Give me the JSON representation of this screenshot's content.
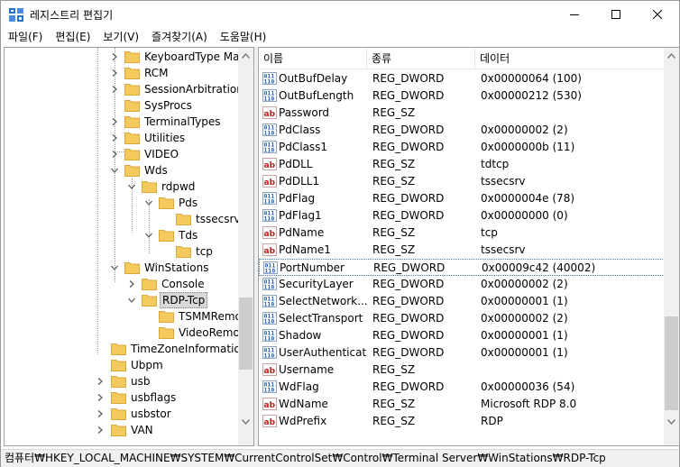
{
  "window": {
    "title": "레지스트리 편집기"
  },
  "menu": [
    "파일(F)",
    "편집(E)",
    "보기(V)",
    "즐겨찾기(A)",
    "도움말(H)"
  ],
  "tree": [
    {
      "label": "KeyboardType Map",
      "expander": "collapsed"
    },
    {
      "label": "RCM",
      "expander": "collapsed"
    },
    {
      "label": "SessionArbitrationHelper",
      "expander": "collapsed"
    },
    {
      "label": "SysProcs",
      "expander": "none"
    },
    {
      "label": "TerminalTypes",
      "expander": "collapsed"
    },
    {
      "label": "Utilities",
      "expander": "collapsed"
    },
    {
      "label": "VIDEO",
      "expander": "collapsed"
    },
    {
      "label": "Wds",
      "expander": "expanded"
    },
    {
      "label": "rdpwd",
      "expander": "expanded"
    },
    {
      "label": "Pds",
      "expander": "expanded"
    },
    {
      "label": "tssecsrv",
      "expander": "none"
    },
    {
      "label": "Tds",
      "expander": "expanded"
    },
    {
      "label": "tcp",
      "expander": "none"
    },
    {
      "label": "WinStations",
      "expander": "expanded"
    },
    {
      "label": "Console",
      "expander": "collapsed"
    },
    {
      "label": "RDP-Tcp",
      "expander": "expanded",
      "selected": true
    },
    {
      "label": "TSMMRemotingAllowedApps",
      "expander": "none"
    },
    {
      "label": "VideoRemotingWindowNames",
      "expander": "none"
    },
    {
      "label": "TimeZoneInformation",
      "expander": "none"
    },
    {
      "label": "Ubpm",
      "expander": "none"
    },
    {
      "label": "usb",
      "expander": "collapsed"
    },
    {
      "label": "usbflags",
      "expander": "collapsed"
    },
    {
      "label": "usbstor",
      "expander": "collapsed"
    },
    {
      "label": "VAN",
      "expander": "collapsed"
    }
  ],
  "list": {
    "columns": [
      "이름",
      "종류",
      "데이터"
    ],
    "rows": [
      {
        "icon": "binary",
        "name": "OutBufDelay",
        "type": "REG_DWORD",
        "data": "0x00000064 (100)"
      },
      {
        "icon": "binary",
        "name": "OutBufLength",
        "type": "REG_DWORD",
        "data": "0x00000212 (530)"
      },
      {
        "icon": "string",
        "name": "Password",
        "type": "REG_SZ",
        "data": ""
      },
      {
        "icon": "binary",
        "name": "PdClass",
        "type": "REG_DWORD",
        "data": "0x00000002 (2)"
      },
      {
        "icon": "binary",
        "name": "PdClass1",
        "type": "REG_DWORD",
        "data": "0x0000000b (11)"
      },
      {
        "icon": "string",
        "name": "PdDLL",
        "type": "REG_SZ",
        "data": "tdtcp"
      },
      {
        "icon": "string",
        "name": "PdDLL1",
        "type": "REG_SZ",
        "data": "tssecsrv"
      },
      {
        "icon": "binary",
        "name": "PdFlag",
        "type": "REG_DWORD",
        "data": "0x0000004e (78)"
      },
      {
        "icon": "binary",
        "name": "PdFlag1",
        "type": "REG_DWORD",
        "data": "0x00000000 (0)"
      },
      {
        "icon": "string",
        "name": "PdName",
        "type": "REG_SZ",
        "data": "tcp"
      },
      {
        "icon": "string",
        "name": "PdName1",
        "type": "REG_SZ",
        "data": "tssecsrv"
      },
      {
        "icon": "binary",
        "name": "PortNumber",
        "type": "REG_DWORD",
        "data": "0x00009c42 (40002)",
        "selected": true
      },
      {
        "icon": "binary",
        "name": "SecurityLayer",
        "type": "REG_DWORD",
        "data": "0x00000002 (2)"
      },
      {
        "icon": "binary",
        "name": "SelectNetwork...",
        "type": "REG_DWORD",
        "data": "0x00000001 (1)"
      },
      {
        "icon": "binary",
        "name": "SelectTransport",
        "type": "REG_DWORD",
        "data": "0x00000002 (2)"
      },
      {
        "icon": "binary",
        "name": "Shadow",
        "type": "REG_DWORD",
        "data": "0x00000001 (1)"
      },
      {
        "icon": "binary",
        "name": "UserAuthenticat...",
        "type": "REG_DWORD",
        "data": "0x00000001 (1)"
      },
      {
        "icon": "string",
        "name": "Username",
        "type": "REG_SZ",
        "data": ""
      },
      {
        "icon": "binary",
        "name": "WdFlag",
        "type": "REG_DWORD",
        "data": "0x00000036 (54)"
      },
      {
        "icon": "string",
        "name": "WdName",
        "type": "REG_SZ",
        "data": "Microsoft RDP 8.0"
      },
      {
        "icon": "string",
        "name": "WdPrefix",
        "type": "REG_SZ",
        "data": "RDP"
      }
    ]
  },
  "status": {
    "path": "컴퓨터₩HKEY_LOCAL_MACHINE₩SYSTEM₩CurrentControlSet₩Control₩Terminal Server₩WinStations₩RDP-Tcp"
  },
  "colors": {
    "folder": "#f4c95d",
    "binary_icon": "#1f5fb5",
    "string_icon": "#b5261f",
    "selected_row_border": "#3c7fb1"
  }
}
